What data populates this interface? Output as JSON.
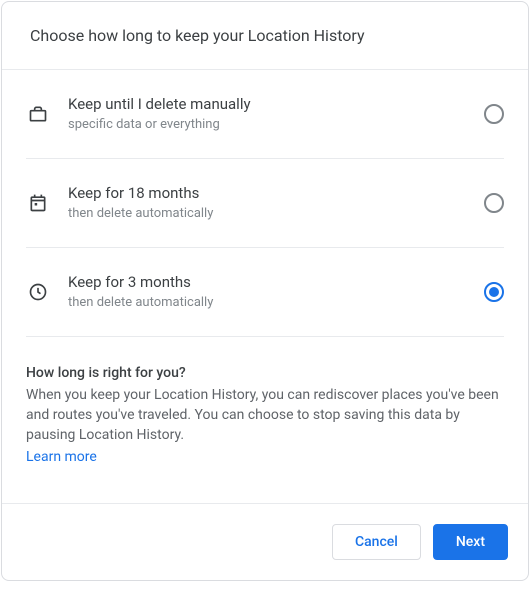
{
  "header": {
    "title": "Choose how long to keep your Location History"
  },
  "options": [
    {
      "icon": "briefcase-icon",
      "title": "Keep until I delete manually",
      "subtitle": "specific data or everything",
      "selected": false
    },
    {
      "icon": "calendar-icon",
      "title": "Keep for 18 months",
      "subtitle": "then delete automatically",
      "selected": false
    },
    {
      "icon": "clock-icon",
      "title": "Keep for 3 months",
      "subtitle": "then delete automatically",
      "selected": true
    }
  ],
  "info": {
    "title": "How long is right for you?",
    "body": "When you keep your Location History, you can rediscover places you've been and routes you've traveled. You can choose to stop saving this data by pausing Location History.",
    "learn_more": "Learn more"
  },
  "footer": {
    "cancel": "Cancel",
    "next": "Next"
  }
}
